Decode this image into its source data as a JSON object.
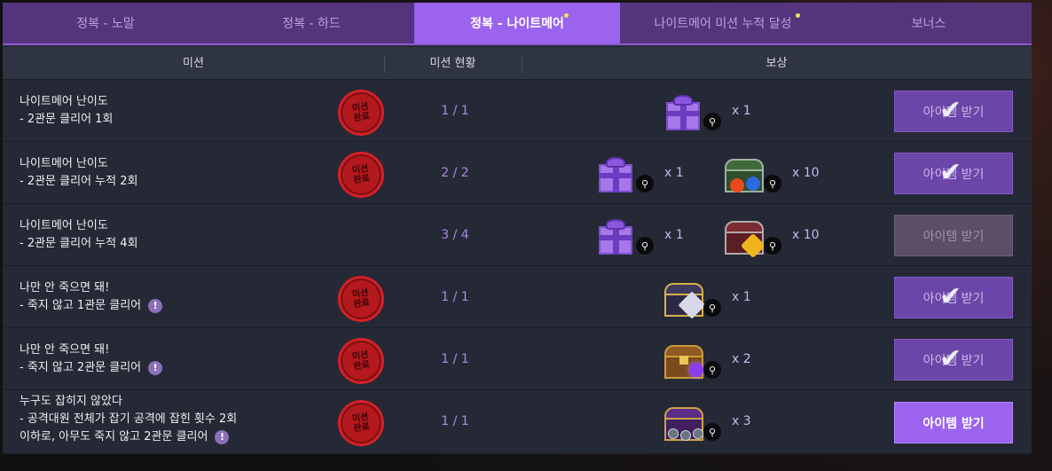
{
  "tabs": [
    {
      "label": "정복 - 노말",
      "active": false,
      "dot": false
    },
    {
      "label": "정복 - 하드",
      "active": false,
      "dot": false
    },
    {
      "label": "정복 - 나이트메어",
      "active": true,
      "dot": true
    },
    {
      "label": "나이트메어 미션 누적 달성",
      "active": false,
      "dot": true
    },
    {
      "label": "보너스",
      "active": false,
      "dot": false
    }
  ],
  "header": {
    "mission": "미션",
    "status": "미션 현황",
    "reward": "보상"
  },
  "stamp_text": [
    "미션",
    "완료"
  ],
  "claim_label": "아이템 받기",
  "rows": [
    {
      "line1": "나이트메어 난이도",
      "line2": "- 2관문 클리어 1회",
      "line3": "",
      "info": false,
      "completed": true,
      "status": "1 / 1",
      "rewards": [
        {
          "icon": "purple-gift-box-icon",
          "qty": "x 1"
        }
      ],
      "claim_state": "claimed"
    },
    {
      "line1": "나이트메어 난이도",
      "line2": "- 2관문 클리어 누적 2회",
      "line3": "",
      "info": false,
      "completed": true,
      "status": "2 / 2",
      "rewards": [
        {
          "icon": "purple-gift-box-icon",
          "qty": "x 1"
        },
        {
          "icon": "green-gem-chest-icon",
          "qty": "x 10"
        }
      ],
      "claim_state": "claimed"
    },
    {
      "line1": "나이트메어 난이도",
      "line2": "- 2관문 클리어 누적 4회",
      "line3": "",
      "info": false,
      "completed": false,
      "status": "3 / 4",
      "rewards": [
        {
          "icon": "purple-gift-box-icon",
          "qty": "x 1"
        },
        {
          "icon": "red-gem-chest-icon",
          "qty": "x 10"
        }
      ],
      "claim_state": "disabled"
    },
    {
      "line1": "나만 안 죽으면 돼!",
      "line2": "- 죽지 않고 1관문 클리어",
      "line3": "",
      "info": true,
      "completed": true,
      "status": "1 / 1",
      "rewards": [
        {
          "icon": "gold-crystal-chest-icon",
          "qty": "x 1"
        }
      ],
      "claim_state": "claimed"
    },
    {
      "line1": "나만 안 죽으면 돼!",
      "line2": "- 죽지 않고 2관문 클리어",
      "line3": "",
      "info": true,
      "completed": true,
      "status": "1 / 1",
      "rewards": [
        {
          "icon": "wooden-orb-chest-icon",
          "qty": "x 2"
        }
      ],
      "claim_state": "claimed"
    },
    {
      "line1": "누구도 잡히지 않았다",
      "line2": "- 공격대원 전체가 잡기 공격에 잡힌 횟수 2회",
      "line3": "이하로, 아무도 죽지 않고 2관문 클리어",
      "info": true,
      "completed": true,
      "status": "1 / 1",
      "rewards": [
        {
          "icon": "purple-rune-chest-icon",
          "qty": "x 3"
        }
      ],
      "claim_state": "ready"
    }
  ],
  "colors": {
    "accent": "#9b63ee",
    "tab_bar": "#54357d",
    "stamp": "#b3191d",
    "status_text": "#a98ae6"
  }
}
